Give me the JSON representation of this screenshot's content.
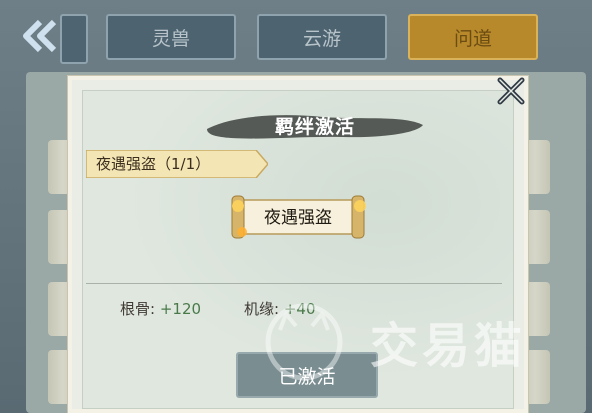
{
  "nav": {
    "back_icon": "double-chevron-left-icon",
    "tabs": [
      {
        "label": "灵兽",
        "active": false
      },
      {
        "label": "云游",
        "active": false
      },
      {
        "label": "问道",
        "active": true
      }
    ]
  },
  "dialog": {
    "title": "羁绊激活",
    "close_icon": "close-icon",
    "bond": {
      "ribbon_label": "夜遇强盗（1/1）",
      "scroll_label": "夜遇强盗"
    },
    "stats": [
      {
        "label": "根骨:",
        "value": "+120"
      },
      {
        "label": "机缘:",
        "value": "+40"
      }
    ],
    "button_label": "已激活"
  },
  "watermark": {
    "text": "交易猫",
    "icon": "cat-logo-icon"
  },
  "colors": {
    "active_tab": "#b7892b",
    "stat_value": "#4a7a4a",
    "button": "#7a8d91"
  }
}
